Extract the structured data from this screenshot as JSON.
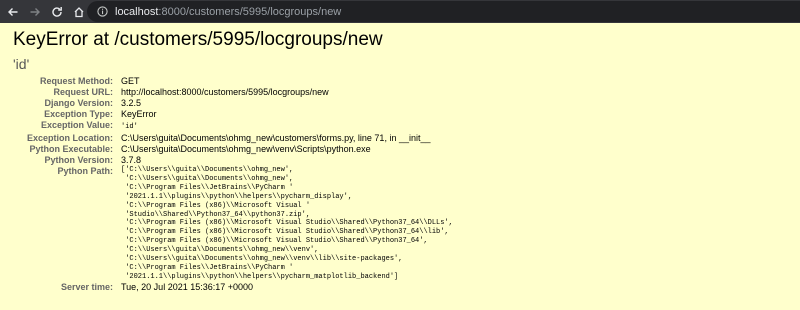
{
  "browser": {
    "url_host": "localhost",
    "url_rest": ":8000/customers/5995/locgroups/new"
  },
  "error": {
    "title": "KeyError at /customers/5995/locgroups/new",
    "exception_value_display": "'id'"
  },
  "meta_rows": [
    {
      "label": "Request Method:",
      "value": "GET"
    },
    {
      "label": "Request URL:",
      "value": "http://localhost:8000/customers/5995/locgroups/new"
    },
    {
      "label": "Django Version:",
      "value": "3.2.5"
    },
    {
      "label": "Exception Type:",
      "value": "KeyError"
    },
    {
      "label": "Exception Value:",
      "value": "'id'"
    },
    {
      "label": "Exception Location:",
      "value": "C:\\Users\\guita\\Documents\\ohmg_new\\customers\\forms.py, line 71, in __init__"
    },
    {
      "label": "Python Executable:",
      "value": "C:\\Users\\guita\\Documents\\ohmg_new\\venv\\Scripts\\python.exe"
    },
    {
      "label": "Python Version:",
      "value": "3.7.8"
    },
    {
      "label": "Python Path:",
      "value": "['C:\\\\Users\\\\guita\\\\Documents\\\\ohmg_new',\n 'C:\\\\Users\\\\guita\\\\Documents\\\\ohmg_new',\n 'C:\\\\Program Files\\\\JetBrains\\\\PyCharm '\n '2021.1.1\\\\plugins\\\\python\\\\helpers\\\\pycharm_display',\n 'C:\\\\Program Files (x86)\\\\Microsoft Visual '\n 'Studio\\\\Shared\\\\Python37_64\\\\python37.zip',\n 'C:\\\\Program Files (x86)\\\\Microsoft Visual Studio\\\\Shared\\\\Python37_64\\\\DLLs',\n 'C:\\\\Program Files (x86)\\\\Microsoft Visual Studio\\\\Shared\\\\Python37_64\\\\lib',\n 'C:\\\\Program Files (x86)\\\\Microsoft Visual Studio\\\\Shared\\\\Python37_64',\n 'C:\\\\Users\\\\guita\\\\Documents\\\\ohmg_new\\\\venv',\n 'C:\\\\Users\\\\guita\\\\Documents\\\\ohmg_new\\\\venv\\\\lib\\\\site-packages',\n 'C:\\\\Program Files\\\\JetBrains\\\\PyCharm '\n '2021.1.1\\\\plugins\\\\python\\\\helpers\\\\pycharm_matplotlib_backend']"
    },
    {
      "label": "Server time:",
      "value": "Tue, 20 Jul 2021 15:36:17 +0000"
    }
  ]
}
